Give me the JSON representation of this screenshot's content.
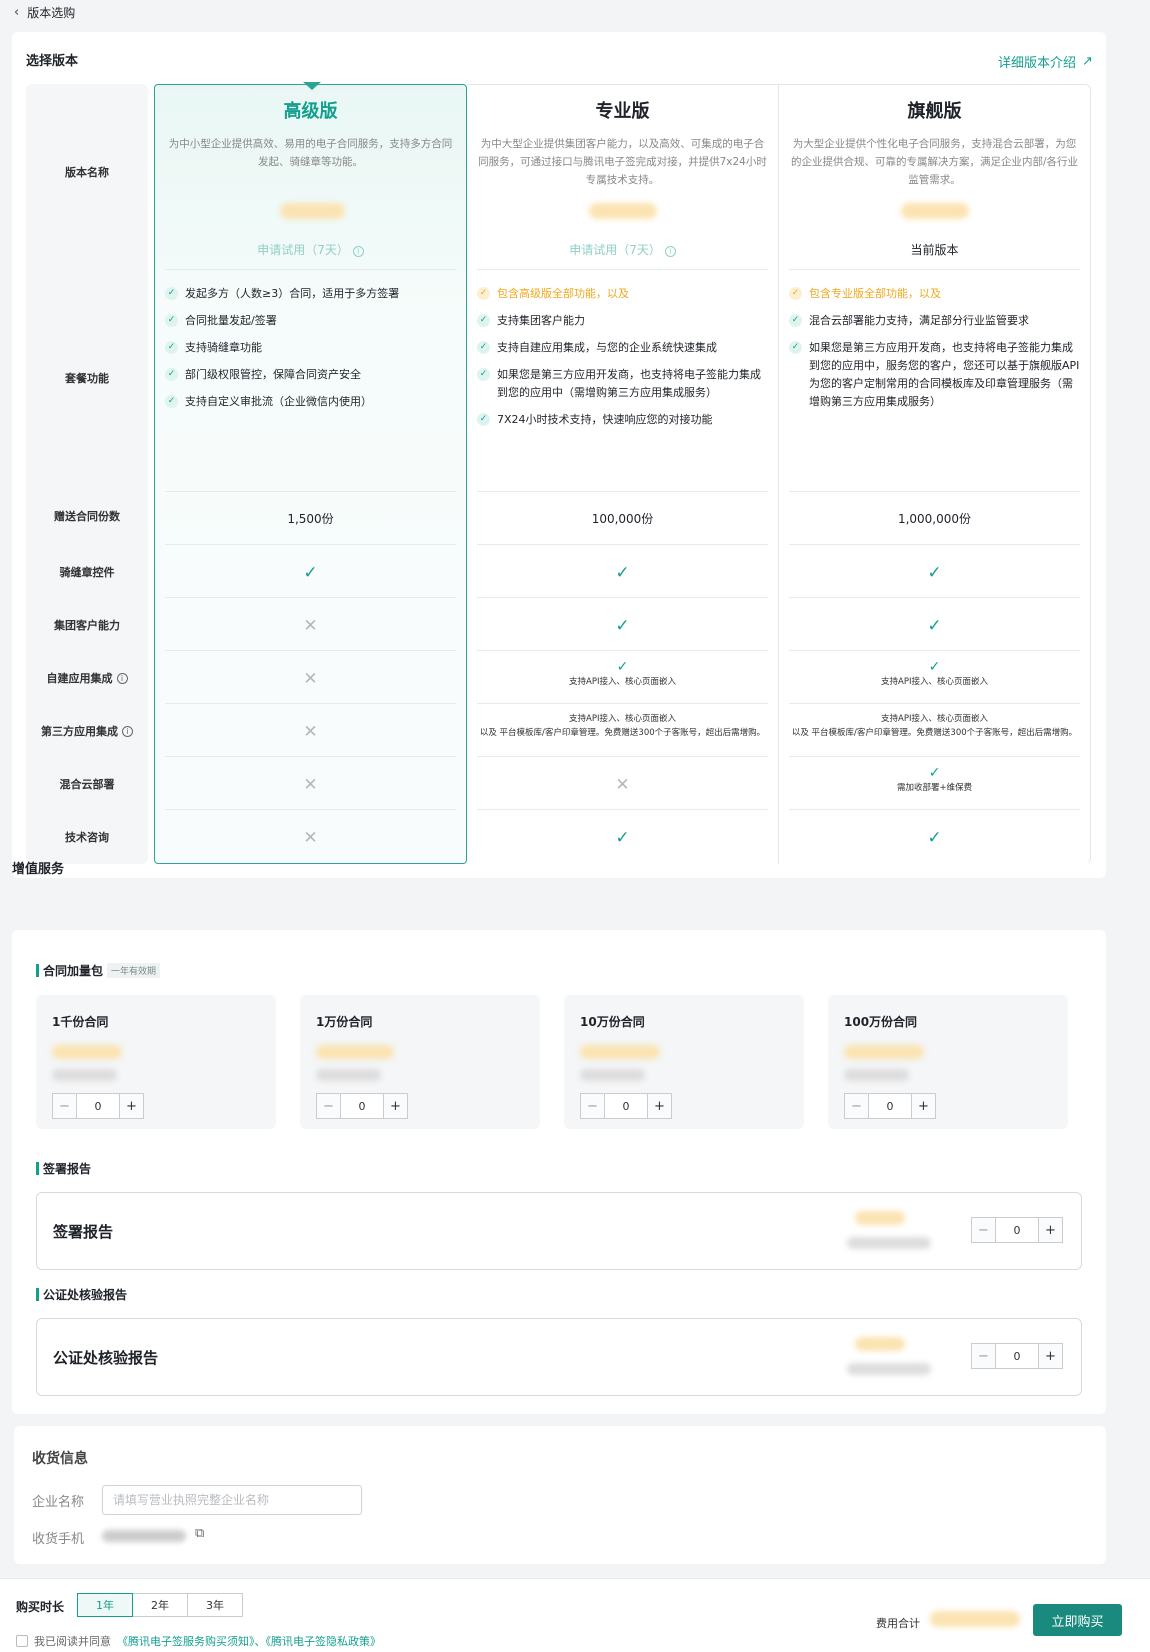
{
  "nav": {
    "back_label": "版本选购"
  },
  "select": {
    "title": "选择版本",
    "detail_link": "详细版本介绍"
  },
  "row_labels": {
    "name": "版本名称",
    "features": "套餐功能",
    "contracts": "赠送合同份数",
    "seal": "骑缝章控件",
    "group": "集团客户能力",
    "selfapp": "自建应用集成",
    "thirdapp": "第三方应用集成",
    "hybrid": "混合云部署",
    "consult": "技术咨询"
  },
  "versions": [
    {
      "name": "高级版",
      "desc": "为中小型企业提供高效、易用的电子合同服务，支持多方合同发起、骑缝章等功能。",
      "action": "申请试用（7天）",
      "features": [
        "发起多方（人数≥3）合同，适用于多方签署",
        "合同批量发起/签署",
        "支持骑缝章功能",
        "部门级权限管控，保障合同资产安全",
        "支持自定义审批流（企业微信内使用）"
      ],
      "contracts": "1,500份"
    },
    {
      "name": "专业版",
      "desc": "为中大型企业提供集团客户能力，以及高效、可集成的电子合同服务，可通过接口与腾讯电子签完成对接，并提供7x24小时专属技术支持。",
      "action": "申请试用（7天）",
      "lead": "包含高级版全部功能，以及",
      "features": [
        "支持集团客户能力",
        "支持自建应用集成，与您的企业系统快速集成",
        "如果您是第三方应用开发商，也支持将电子签能力集成到您的应用中（需增购第三方应用集成服务）",
        "7X24小时技术支持，快速响应您的对接功能"
      ],
      "contracts": "100,000份",
      "selfapp_note": "支持API接入、核心页面嵌入",
      "third_note1": "支持API接入、核心页面嵌入",
      "third_note2": "以及 平台模板库/客户印章管理。免费赠送300个子客账号，超出后需增购。"
    },
    {
      "name": "旗舰版",
      "desc": "为大型企业提供个性化电子合同服务，支持混合云部署，为您的企业提供合规、可靠的专属解决方案，满足企业内部/各行业监管需求。",
      "action": "当前版本",
      "lead": "包含专业版全部功能，以及",
      "features": [
        "混合云部署能力支持，满足部分行业监管要求",
        "如果您是第三方应用开发商，也支持将电子签能力集成到您的应用中，服务您的客户，您还可以基于旗舰版API为您的客户定制常用的合同模板库及印章管理服务（需增购第三方应用集成服务）"
      ],
      "contracts": "1,000,000份",
      "selfapp_note": "支持API接入、核心页面嵌入",
      "third_note1": "支持API接入、核心页面嵌入",
      "third_note2": "以及 平台模板库/客户印章管理。免费赠送300个子客账号，超出后需增购。",
      "hybrid_note": "需加收部署+维保费"
    }
  ],
  "value_services": {
    "title": "增值服务",
    "pack_title": "合同加量包",
    "pack_tag": "一年有效期",
    "packs": [
      {
        "name": "1千份合同",
        "qty": "0"
      },
      {
        "name": "1万份合同",
        "qty": "0"
      },
      {
        "name": "10万份合同",
        "qty": "0"
      },
      {
        "name": "100万份合同",
        "qty": "0"
      }
    ],
    "sign_report_section": "签署报告",
    "sign_report_name": "签署报告",
    "sign_report_qty": "0",
    "notary_section": "公证处核验报告",
    "notary_name": "公证处核验报告",
    "notary_qty": "0"
  },
  "shipping": {
    "title": "收货信息",
    "company_label": "企业名称",
    "company_placeholder": "请填写营业执照完整企业名称",
    "phone_label": "收货手机"
  },
  "footer": {
    "duration_label": "购买时长",
    "durations": [
      "1年",
      "2年",
      "3年"
    ],
    "selected": "1年",
    "agree_text": "我已阅读并同意",
    "agree_links": "《腾讯电子签服务购买须知》、《腾讯电子签隐私政策》",
    "total_label": "费用合计",
    "buy_label": "立即购买"
  },
  "colors": {
    "accent": "#139f8f",
    "highlight": "#f0a81e"
  }
}
